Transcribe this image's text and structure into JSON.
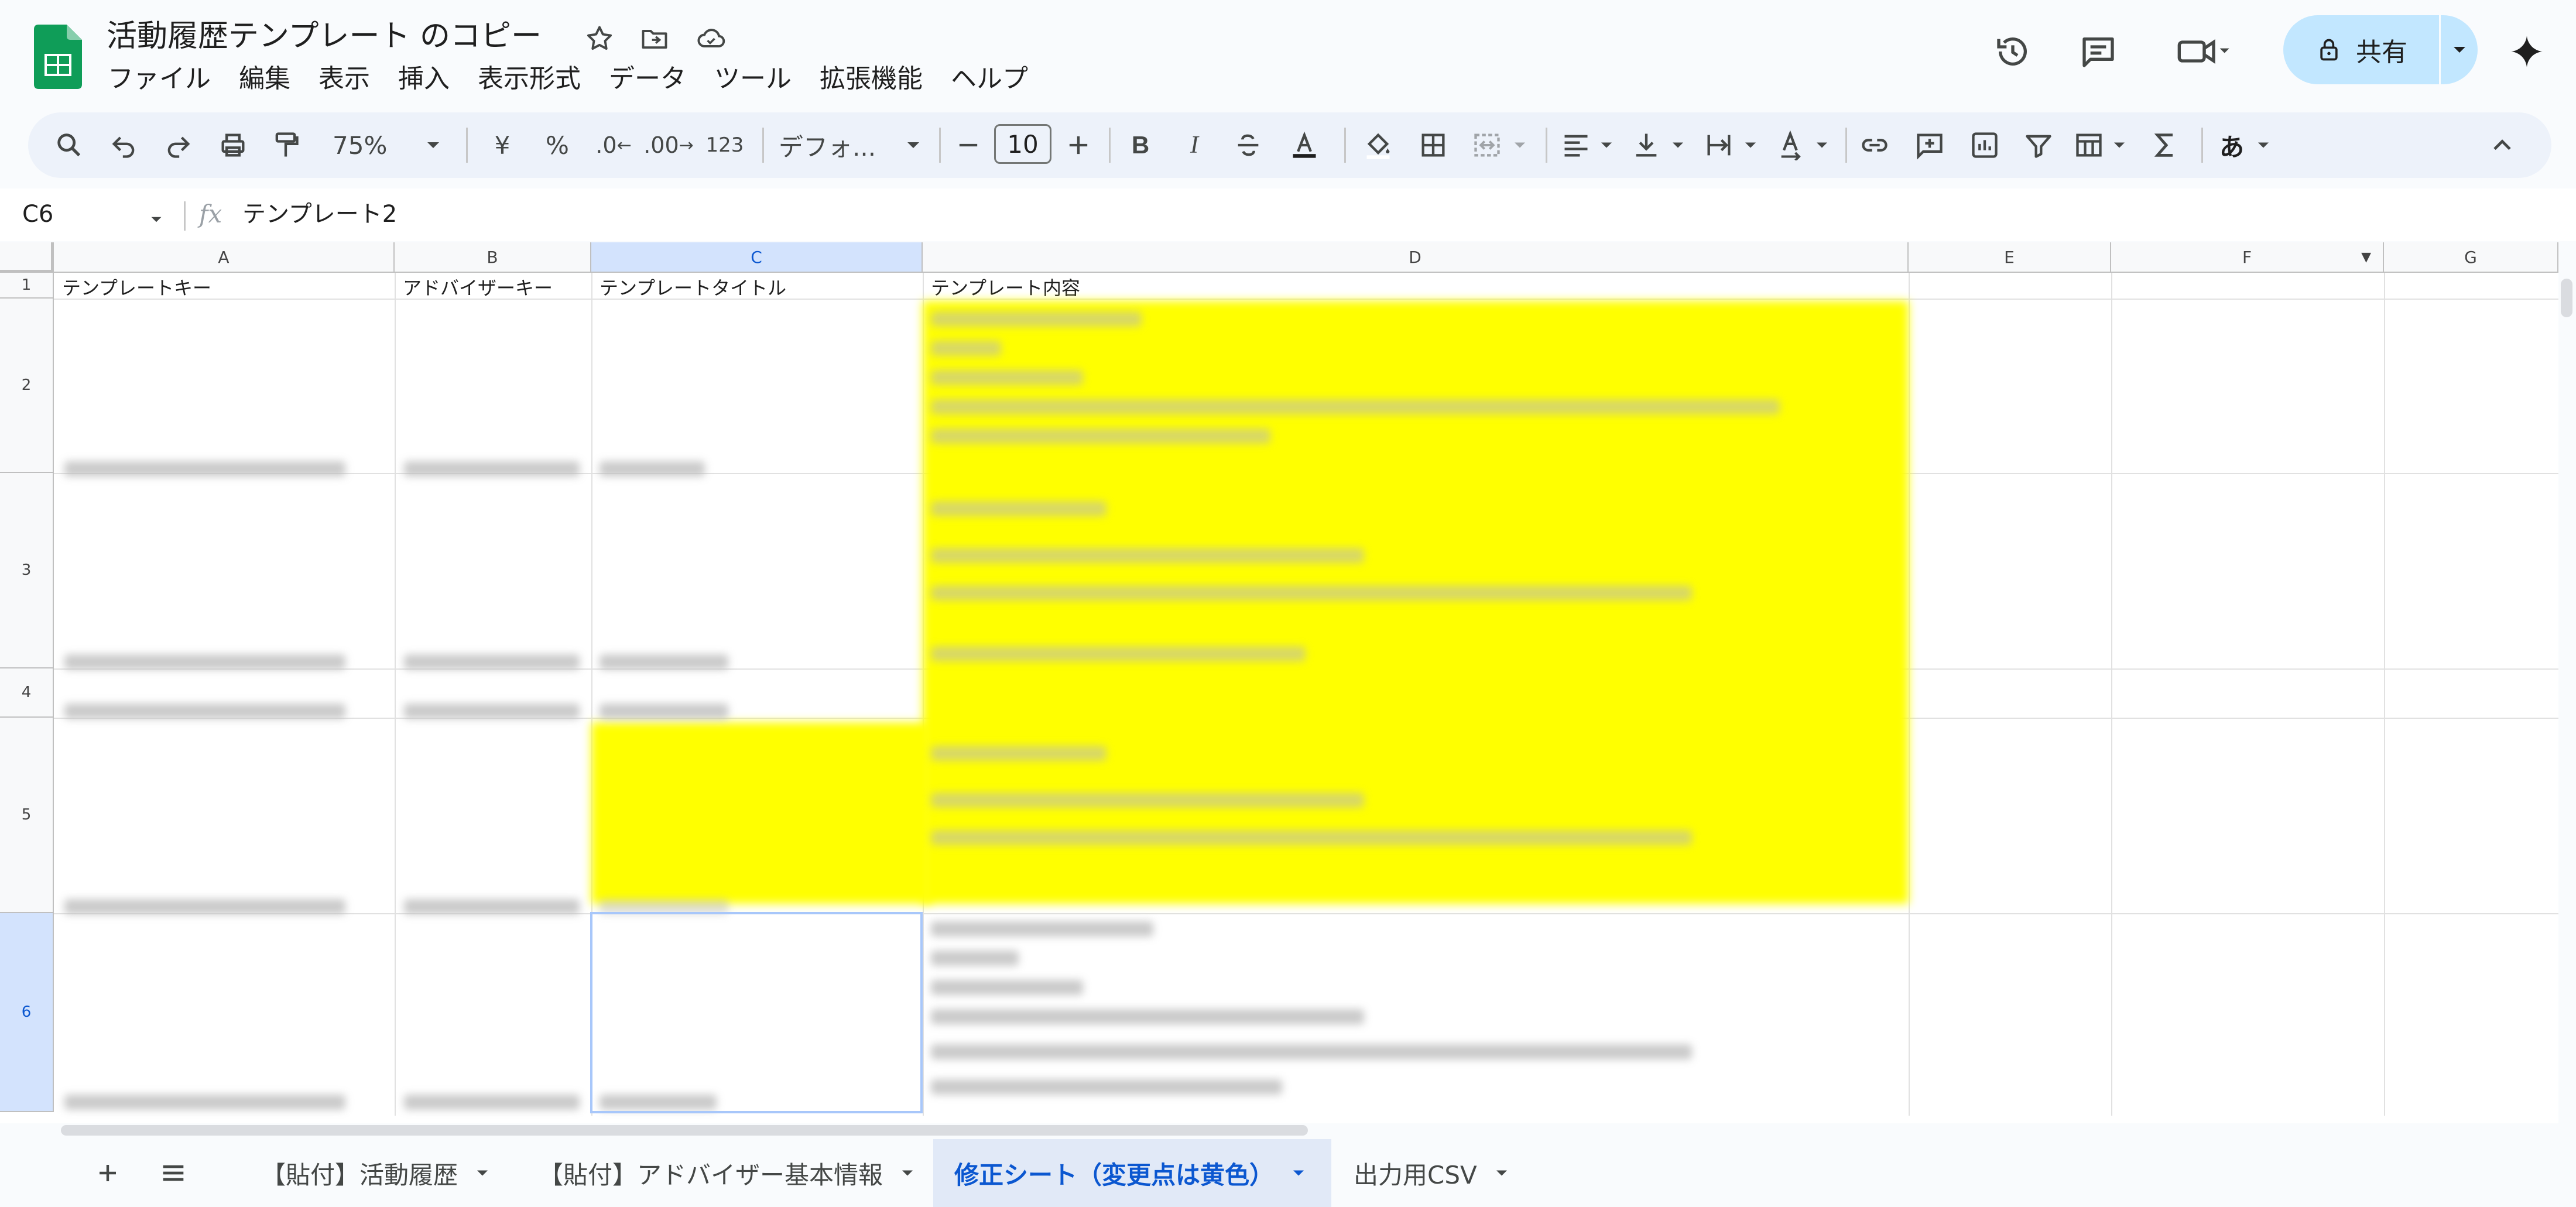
{
  "app": {
    "doc_title": "活動履歴テンプレート のコピー",
    "menu": [
      "ファイル",
      "編集",
      "表示",
      "挿入",
      "表示形式",
      "データ",
      "ツール",
      "拡張機能",
      "ヘルプ"
    ],
    "share_label": "共有"
  },
  "toolbar": {
    "zoom": "75%",
    "currency": "¥",
    "percent": "%",
    "dec_decrease": ".0",
    "dec_increase": ".00",
    "number_format": "123",
    "font": "デフォ...",
    "font_size": "10",
    "bold": "B",
    "italic": "I",
    "input_tools": "あ"
  },
  "formula_bar": {
    "name_box": "C6",
    "fx": "fx",
    "content": "テンプレート2"
  },
  "grid": {
    "columns": [
      "A",
      "B",
      "C",
      "D",
      "E",
      "F",
      "G"
    ],
    "rows": [
      "1",
      "2",
      "3",
      "4",
      "5",
      "6"
    ],
    "header_row": [
      "テンプレートキー",
      "アドバイザーキー",
      "テンプレートタイトル",
      "テンプレート内容"
    ],
    "selected_cell": "C6",
    "highlight_color": "#ffff00"
  },
  "sheets": [
    {
      "label": "【貼付】活動履歴",
      "active": false
    },
    {
      "label": "【貼付】アドバイザー基本情報",
      "active": false
    },
    {
      "label": "修正シート（変更点は黄色）",
      "active": true
    },
    {
      "label": "出力用CSV",
      "active": false
    }
  ]
}
